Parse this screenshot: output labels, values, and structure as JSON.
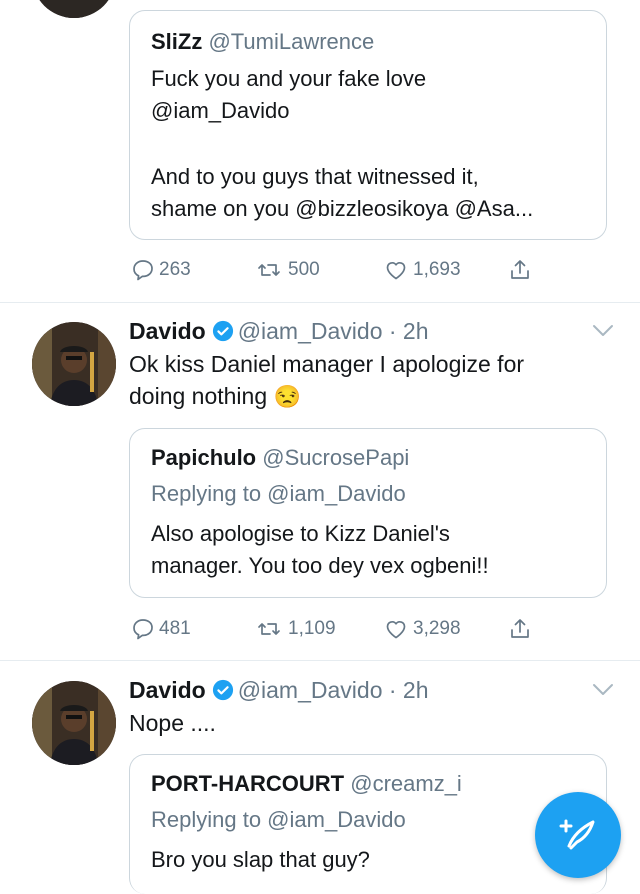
{
  "tweets": [
    {
      "quote": {
        "name": "SliZz",
        "handle": "@TumiLawrence",
        "lines": [
          "Fuck you and your fake love",
          "@iam_Davido",
          "",
          "And to you guys that witnessed it,",
          "shame on you @bizzleosikoya @Asa..."
        ]
      },
      "actions": {
        "replies": "263",
        "retweets": "500",
        "likes": "1,693"
      }
    },
    {
      "name": "Davido",
      "handle": "@iam_Davido",
      "time": "· 2h",
      "text_lines": [
        "Ok kiss Daniel manager I apologize for",
        "doing nothing"
      ],
      "emoji": "😒",
      "quote": {
        "name": "Papichulo",
        "handle": "@SucrosePapi",
        "replying": "Replying to @iam_Davido",
        "lines": [
          "Also apologise to Kizz Daniel's",
          "manager. You too dey vex ogbeni!!"
        ]
      },
      "actions": {
        "replies": "481",
        "retweets": "1,109",
        "likes": "3,298"
      }
    },
    {
      "name": "Davido",
      "handle": "@iam_Davido",
      "time": "· 2h",
      "text_lines": [
        "Nope ...."
      ],
      "quote": {
        "name": "PORT-HARCOURT",
        "handle": "@creamz_i",
        "replying": "Replying to @iam_Davido",
        "lines": [
          "Bro you slap that guy?"
        ]
      }
    }
  ],
  "colors": {
    "accent": "#1da1f2",
    "muted": "#657786",
    "border": "#ccd6dd"
  },
  "icons": [
    "reply-icon",
    "retweet-icon",
    "like-icon",
    "share-icon",
    "verified-icon",
    "chevron-down-icon",
    "compose-icon"
  ]
}
